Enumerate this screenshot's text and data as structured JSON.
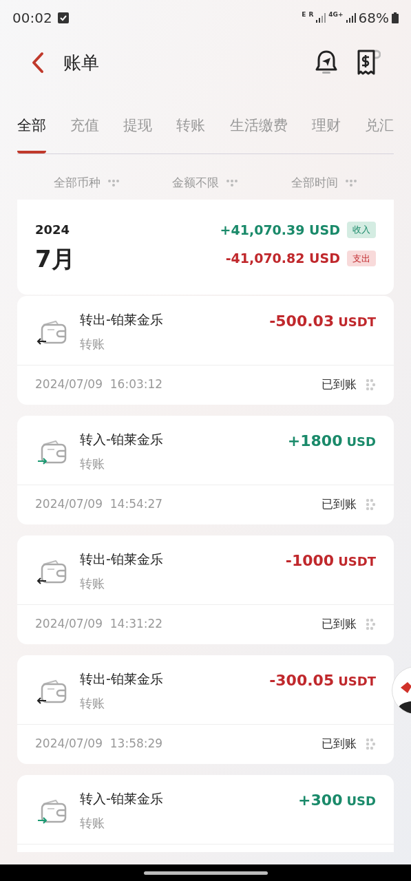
{
  "status_bar": {
    "time": "00:02",
    "network_1": "E",
    "network_2": "R",
    "network_3": "4G+",
    "battery": "68%"
  },
  "header": {
    "title": "账单"
  },
  "tabs": [
    {
      "label": "全部",
      "selected": true
    },
    {
      "label": "充值",
      "selected": false
    },
    {
      "label": "提现",
      "selected": false
    },
    {
      "label": "转账",
      "selected": false
    },
    {
      "label": "生活缴费",
      "selected": false
    },
    {
      "label": "理财",
      "selected": false
    },
    {
      "label": "兑汇",
      "selected": false
    }
  ],
  "filters": [
    "全部币种",
    "金额不限",
    "全部时间"
  ],
  "summary": {
    "year": "2024",
    "month": "7月",
    "income": "+41,070.39 USD",
    "income_label": "收入",
    "expense": "-41,070.82 USD",
    "expense_label": "支出"
  },
  "transactions": [
    {
      "kind": "out",
      "title": "转出-铂莱金乐",
      "category": "转账",
      "amount": "-500.03",
      "currency": "USDT",
      "datetime": "2024/07/09  16:03:12",
      "status": "已到账"
    },
    {
      "kind": "in",
      "title": "转入-铂莱金乐",
      "category": "转账",
      "amount": "+1800",
      "currency": "USD",
      "datetime": "2024/07/09  14:54:27",
      "status": "已到账"
    },
    {
      "kind": "out",
      "title": "转出-铂莱金乐",
      "category": "转账",
      "amount": "-1000",
      "currency": "USDT",
      "datetime": "2024/07/09  14:31:22",
      "status": "已到账"
    },
    {
      "kind": "out",
      "title": "转出-铂莱金乐",
      "category": "转账",
      "amount": "-300.05",
      "currency": "USDT",
      "datetime": "2024/07/09  13:58:29",
      "status": "已到账"
    },
    {
      "kind": "in",
      "title": "转入-铂莱金乐",
      "category": "转账",
      "amount": "+300",
      "currency": "USD"
    }
  ]
}
